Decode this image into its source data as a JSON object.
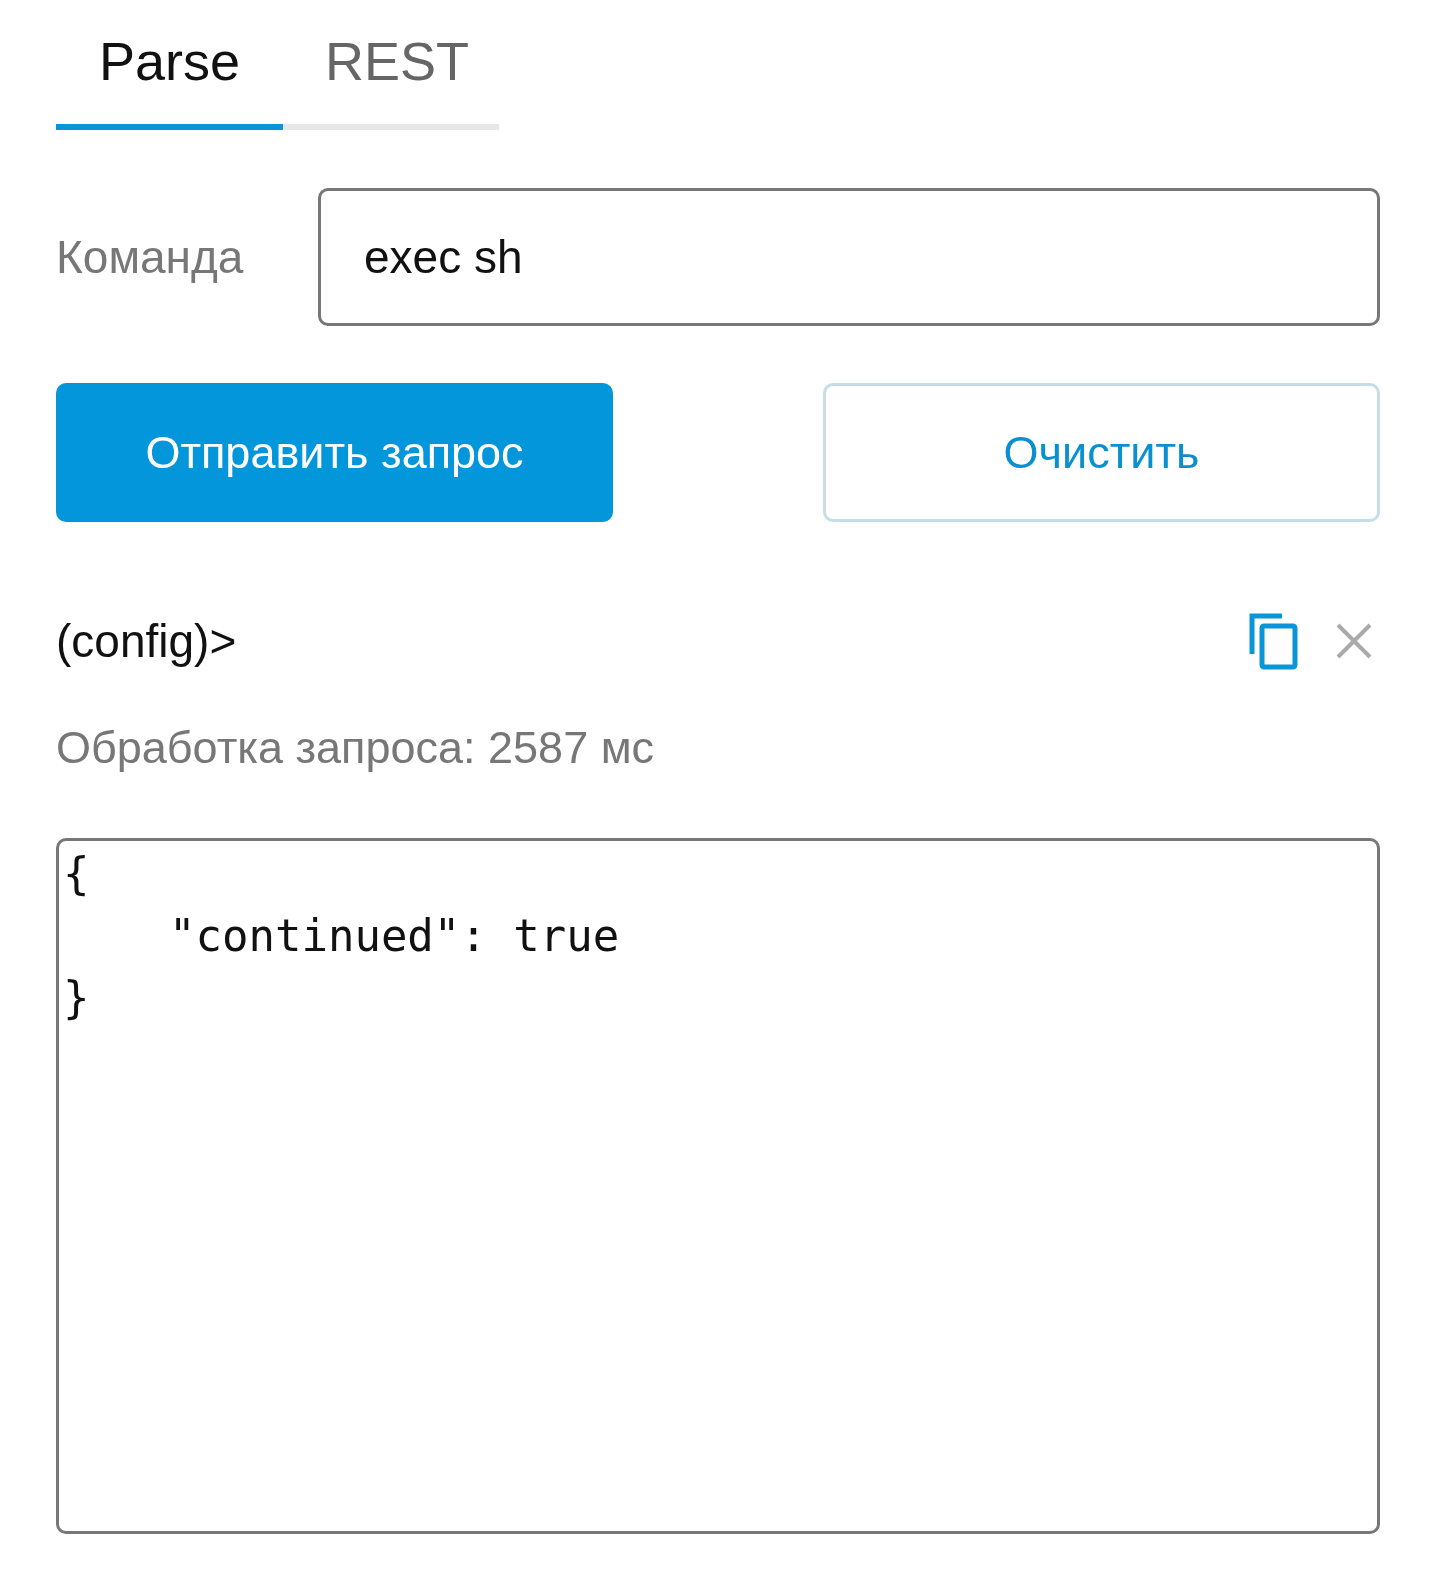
{
  "tabs": [
    {
      "label": "Parse",
      "selected": true
    },
    {
      "label": "REST",
      "selected": false
    }
  ],
  "command": {
    "label": "Команда",
    "value": "exec sh"
  },
  "buttons": [
    {
      "label": "Отправить запрос",
      "kind": "primary"
    },
    {
      "label": "Очистить",
      "kind": "secondary"
    }
  ],
  "result": {
    "prompt": "(config)>",
    "timing": "Обработка запроса: 2587 мс",
    "output": "{\n    \"continued\": true\n}"
  }
}
